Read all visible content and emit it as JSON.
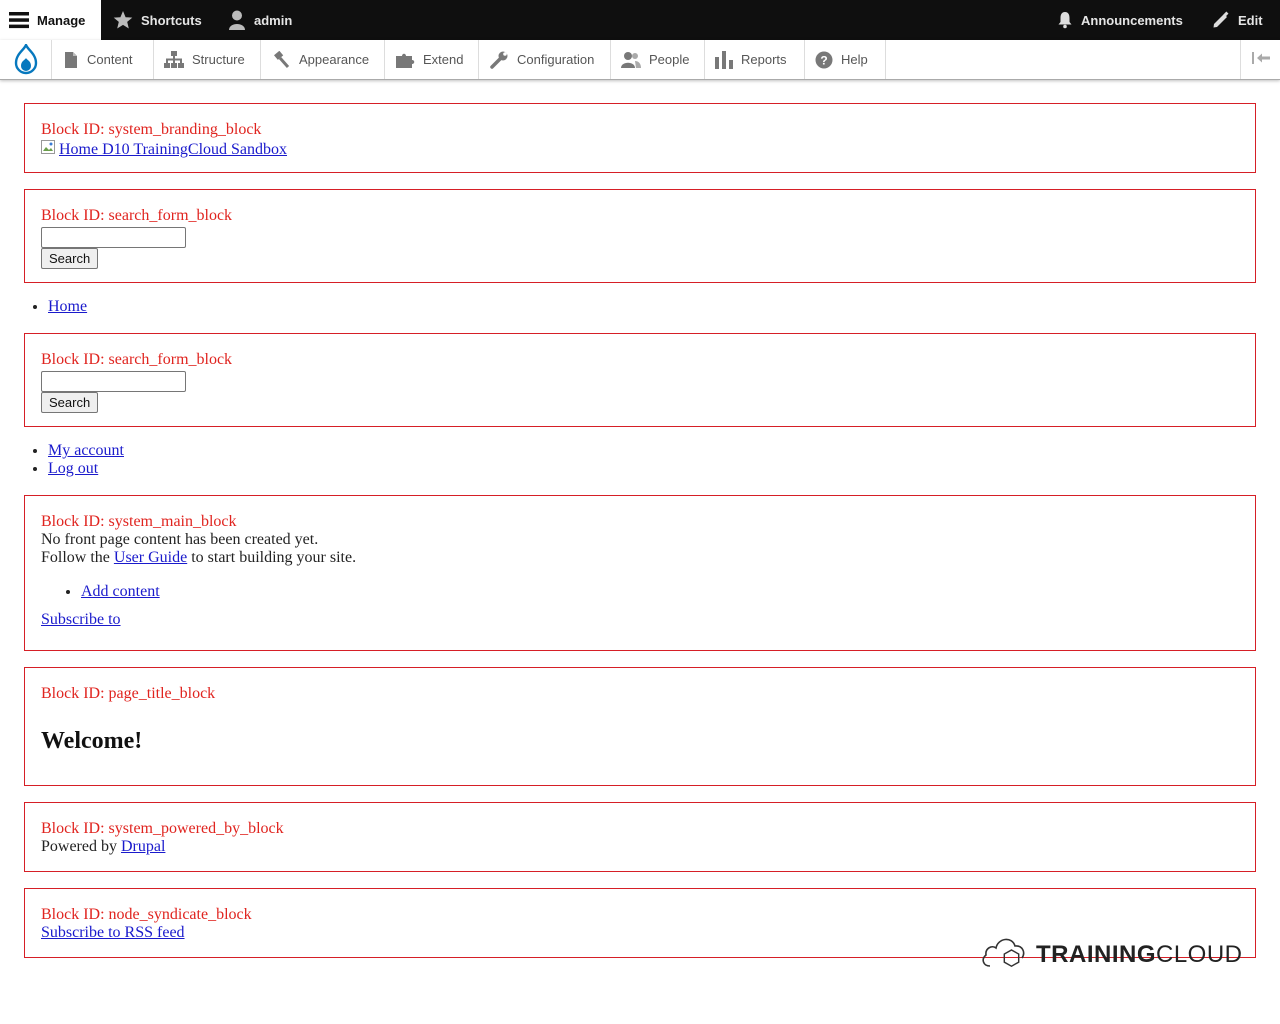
{
  "toolbar": {
    "manage": "Manage",
    "shortcuts": "Shortcuts",
    "user": "admin",
    "announcements": "Announcements",
    "edit": "Edit"
  },
  "tray": {
    "items": [
      {
        "label": "Content",
        "icon": "file-icon"
      },
      {
        "label": "Structure",
        "icon": "sitemap-icon"
      },
      {
        "label": "Appearance",
        "icon": "paint-icon"
      },
      {
        "label": "Extend",
        "icon": "puzzle-icon"
      },
      {
        "label": "Configuration",
        "icon": "wrench-icon"
      },
      {
        "label": "People",
        "icon": "people-icon"
      },
      {
        "label": "Reports",
        "icon": "bar-chart-icon"
      },
      {
        "label": "Help",
        "icon": "help-icon"
      }
    ]
  },
  "blocks": {
    "branding": {
      "id": "Block ID: system_branding_block",
      "link": "Home D10 TrainingCloud Sandbox"
    },
    "search1": {
      "id": "Block ID: search_form_block",
      "input_value": "",
      "button": "Search"
    },
    "main_menu": [
      "Home"
    ],
    "search2": {
      "id": "Block ID: search_form_block",
      "input_value": "",
      "button": "Search"
    },
    "account_menu": [
      "My account",
      "Log out"
    ],
    "main": {
      "id": "Block ID: system_main_block",
      "line1": "No front page content has been created yet.",
      "follow_prefix": "Follow the ",
      "user_guide": "User Guide",
      "follow_suffix": " to start building your site.",
      "add_content": "Add content",
      "subscribe": "Subscribe to"
    },
    "page_title": {
      "id": "Block ID: page_title_block",
      "title": "Welcome!"
    },
    "powered": {
      "id": "Block ID: system_powered_by_block",
      "prefix": "Powered by ",
      "link": "Drupal"
    },
    "syndicate": {
      "id": "Block ID: node_syndicate_block",
      "link": "Subscribe to RSS feed"
    }
  },
  "brand_logo": {
    "text_bold": "TRAINING",
    "text_light": "CLOUD"
  },
  "colors": {
    "toolbar_bg": "#0f0f0f",
    "block_border": "#d61f26",
    "block_id_text": "#e0241f",
    "link": "#1a1acc",
    "drupal_blue": "#0678be"
  }
}
